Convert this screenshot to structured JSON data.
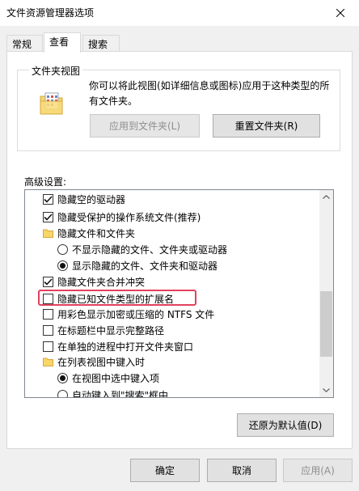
{
  "window": {
    "title": "文件资源管理器选项",
    "close_label": "关闭"
  },
  "tabs": [
    {
      "label": "常规"
    },
    {
      "label": "查看"
    },
    {
      "label": "搜索"
    }
  ],
  "folder_views": {
    "legend": "文件夹视图",
    "description": "你可以将此视图(如详细信息或图标)应用于这种类型的所有文件夹。",
    "apply_button": "应用到文件夹(L)",
    "reset_button": "重置文件夹(R)"
  },
  "advanced": {
    "label": "高级设置:",
    "items": [
      {
        "kind": "checkbox",
        "checked": true,
        "label": "隐藏空的驱动器"
      },
      {
        "kind": "checkbox",
        "checked": true,
        "label": "隐藏受保护的操作系统文件(推荐)"
      },
      {
        "kind": "folder",
        "label": "隐藏文件和文件夹"
      },
      {
        "kind": "radio",
        "checked": false,
        "label": "不显示隐藏的文件、文件夹或驱动器"
      },
      {
        "kind": "radio",
        "checked": true,
        "label": "显示隐藏的文件、文件夹和驱动器"
      },
      {
        "kind": "checkbox",
        "checked": true,
        "label": "隐藏文件夹合并冲突"
      },
      {
        "kind": "checkbox",
        "checked": false,
        "label": "隐藏已知文件类型的扩展名"
      },
      {
        "kind": "checkbox",
        "checked": false,
        "label": "用彩色显示加密或压缩的 NTFS 文件"
      },
      {
        "kind": "checkbox",
        "checked": false,
        "label": "在标题栏中显示完整路径"
      },
      {
        "kind": "checkbox",
        "checked": false,
        "label": "在单独的进程中打开文件夹窗口"
      },
      {
        "kind": "folder",
        "label": "在列表视图中键入时"
      },
      {
        "kind": "radio",
        "checked": true,
        "label": "在视图中选中键入项"
      },
      {
        "kind": "radio",
        "checked": false,
        "label": "自动键入到\"搜索\"框中"
      }
    ],
    "restore_button": "还原为默认值(D)"
  },
  "footer": {
    "ok": "确定",
    "cancel": "取消",
    "apply": "应用(A)"
  },
  "colors": {
    "highlight": "#e2415c",
    "accent": "#0078d7"
  }
}
